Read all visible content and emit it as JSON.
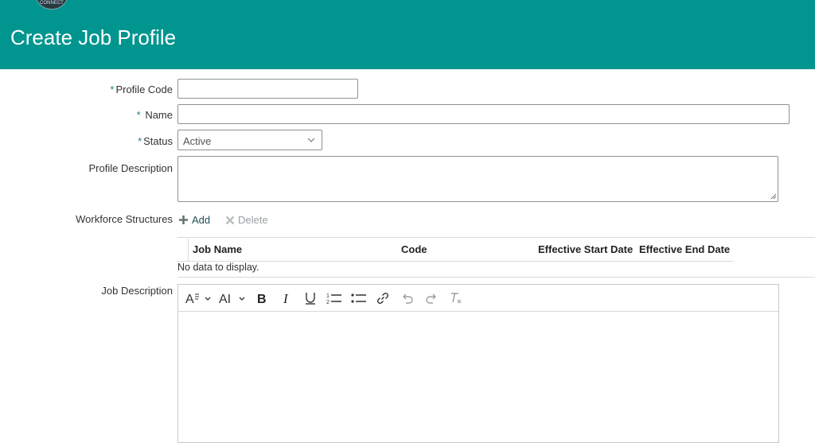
{
  "header": {
    "title": "Create Job Profile",
    "logo_text": "CONNECT"
  },
  "form": {
    "profile_code": {
      "label": "Profile Code",
      "required_mark": "*",
      "value": ""
    },
    "name": {
      "label": "Name",
      "required_mark": "*",
      "value": ""
    },
    "status": {
      "label": "Status",
      "required_mark": "*",
      "selected": "Active"
    },
    "profile_description": {
      "label": "Profile Description",
      "value": ""
    }
  },
  "workforce": {
    "label": "Workforce Structures",
    "add_label": "Add",
    "delete_label": "Delete",
    "columns": [
      "Job Name",
      "Code",
      "Effective Start Date",
      "Effective End Date"
    ],
    "empty_text": "No data to display."
  },
  "job_description": {
    "label": "Job Description",
    "value": ""
  },
  "toolbar_icons": [
    "font-style-icon",
    "font-size-icon",
    "bold-icon",
    "italic-icon",
    "underline-icon",
    "numbered-list-icon",
    "bullet-list-icon",
    "link-icon",
    "undo-icon",
    "redo-icon",
    "clear-format-icon"
  ],
  "colors": {
    "header_bg": "#00958f",
    "required": "#1a7f86",
    "add": "#1e4f55",
    "disabled": "#9aa0a3"
  }
}
